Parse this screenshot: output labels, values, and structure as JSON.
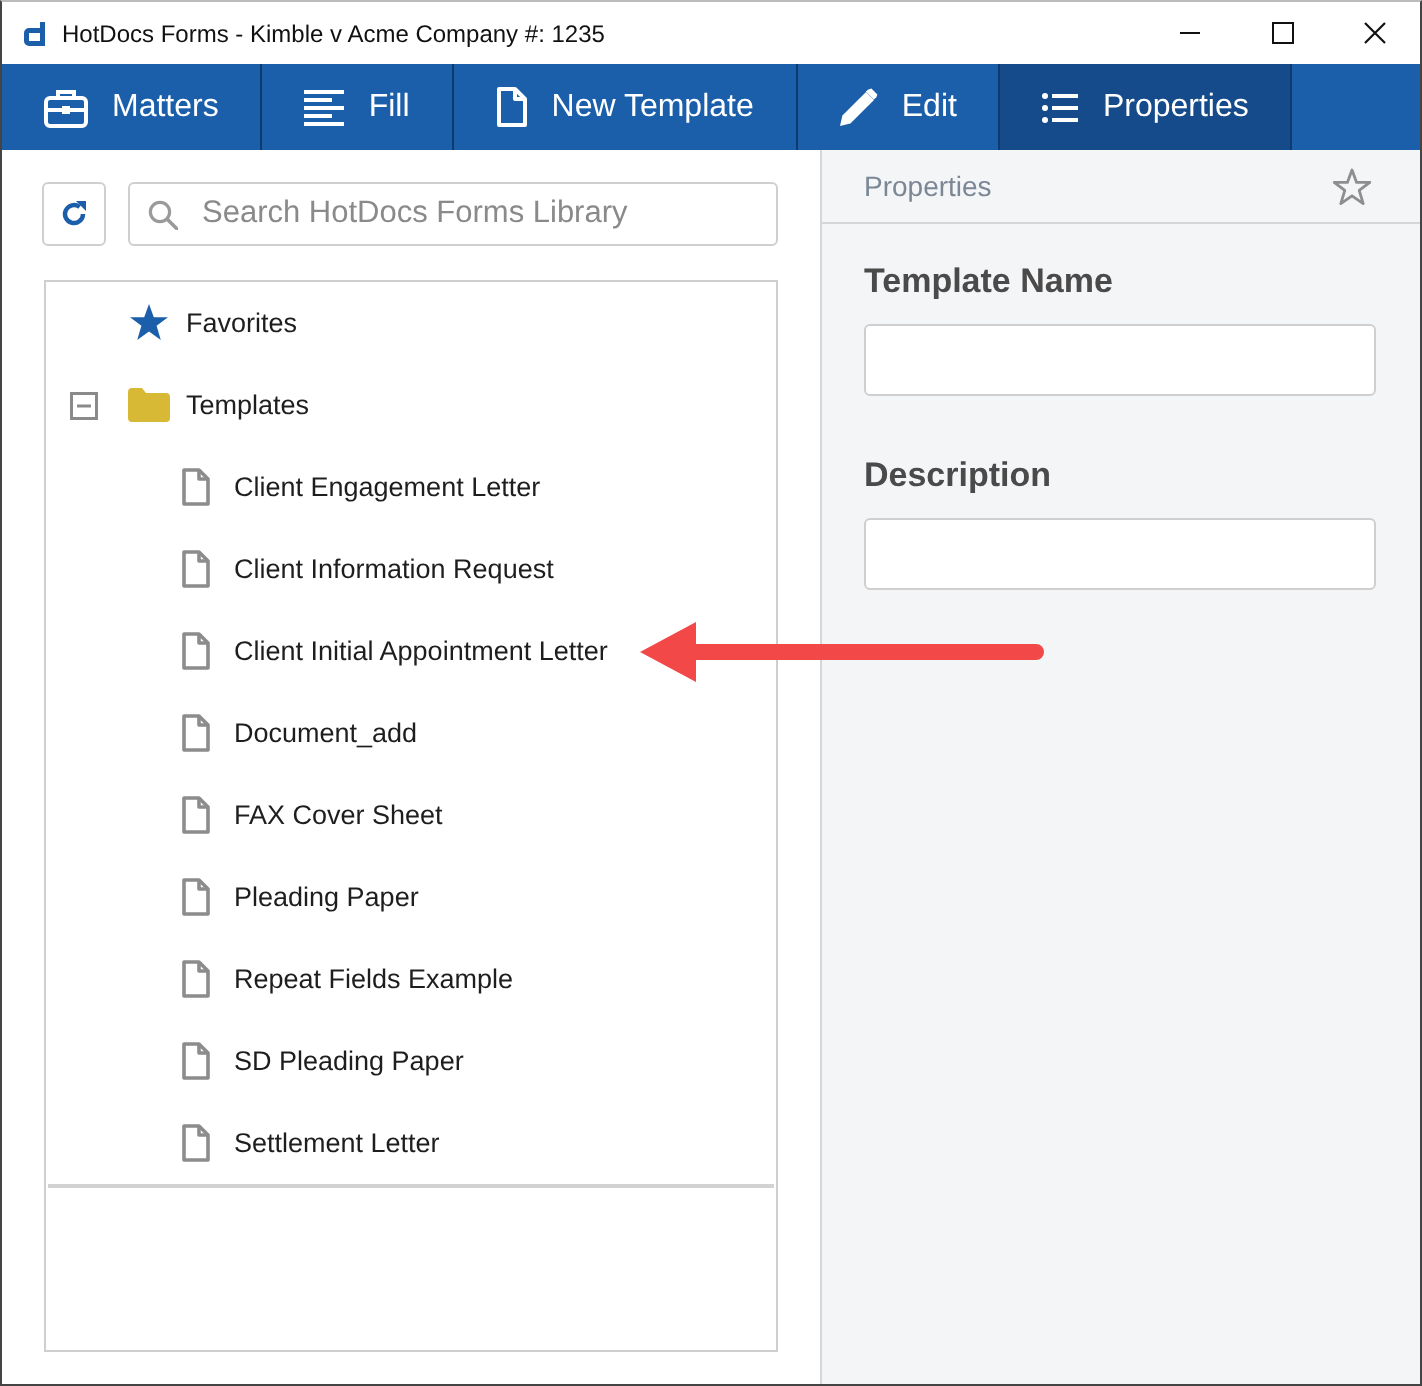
{
  "window": {
    "title": "HotDocs Forms - Kimble v Acme Company #: 1235"
  },
  "toolbar": {
    "tabs": [
      {
        "label": "Matters",
        "selected": false
      },
      {
        "label": "Fill",
        "selected": false
      },
      {
        "label": "New Template",
        "selected": false
      },
      {
        "label": "Edit",
        "selected": false
      },
      {
        "label": "Properties",
        "selected": true
      }
    ]
  },
  "library": {
    "search": {
      "placeholder": "Search HotDocs Forms Library"
    },
    "tree": [
      {
        "label": "Favorites",
        "kind": "favorites"
      },
      {
        "label": "Templates",
        "kind": "folder",
        "expanded": true,
        "children": [
          {
            "label": "Client Engagement Letter",
            "kind": "file",
            "annotated": false
          },
          {
            "label": "Client Information Request",
            "kind": "file",
            "annotated": false
          },
          {
            "label": "Client Initial Appointment Letter",
            "kind": "file",
            "annotated": true
          },
          {
            "label": "Document_add",
            "kind": "file",
            "annotated": false
          },
          {
            "label": "FAX Cover Sheet",
            "kind": "file",
            "annotated": false
          },
          {
            "label": "Pleading Paper",
            "kind": "file",
            "annotated": false
          },
          {
            "label": "Repeat Fields Example",
            "kind": "file",
            "annotated": false
          },
          {
            "label": "SD Pleading Paper",
            "kind": "file",
            "annotated": false
          },
          {
            "label": "Settlement Letter",
            "kind": "file",
            "annotated": false
          }
        ]
      }
    ]
  },
  "properties": {
    "title": "Properties",
    "starred": false,
    "fields": [
      {
        "label": "Template Name"
      },
      {
        "label": "Description"
      }
    ]
  }
}
